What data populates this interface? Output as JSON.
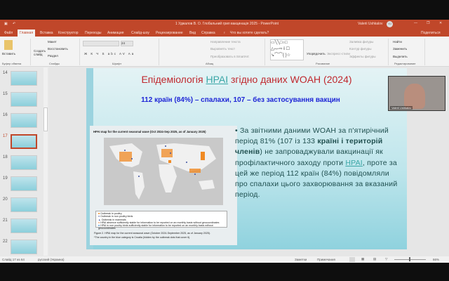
{
  "window": {
    "title": "1 Уджалов В. О. Глобальний грип вакцинація 2025 - PowerPoint",
    "user": "Valerii Ushkalov",
    "user_initials": "VU"
  },
  "tabs": [
    "Файл",
    "Главная",
    "Вставка",
    "Конструктор",
    "Переходы",
    "Анимация",
    "Слайд-шоу",
    "Рецензирование",
    "Вид",
    "Справка"
  ],
  "tell_me": "Что вы хотите сделать?",
  "share": "Поделиться",
  "ribbon": {
    "paste": "Вставить",
    "new_slide": "Создать слайд",
    "layout": "Макет",
    "reset": "Восстановить",
    "section": "Раздел",
    "font_size": "24",
    "text_direction": "Направление текста",
    "align_text": "Выровнять текст",
    "smartart": "Преобразовать в SmartArt",
    "arrange": "Упорядочить",
    "quick_styles": "Экспресс-стили",
    "fill": "Заливка фигуры",
    "outline": "Контур фигуры",
    "effects": "Эффекты фигуры",
    "find": "Найти",
    "replace": "Заменить",
    "select": "Выделить",
    "groups": [
      "Буфер обмена",
      "Слайды",
      "Шрифт",
      "Абзац",
      "Рисование",
      "Редактирование"
    ]
  },
  "thumbnails": [
    "14",
    "15",
    "16",
    "17",
    "18",
    "19",
    "20",
    "21",
    "22"
  ],
  "selected_slide": "17",
  "slide": {
    "title_a": "Епідеміологія ",
    "title_hpai": "HPAI",
    "title_b": " згідно  даних  WOAH (2024)",
    "subtitle": "112 країн (84%) – спалахи, 107 – без застосування вакцин",
    "map_title": "HPAI map for the current seasonal wave (Oct 2024-Sep 2025, as of January 2025)",
    "legend": [
      "Outbreak in poultry",
      "Outbreak in non poultry birds",
      "Outbreak in mammals",
      "HPAI absence sufficiently stable for information to be reported on an monthly basis without geocoordinates",
      "HPAI in non poultry birds sufficiently stable for information to be reported on an monthly basis without geocoordinates"
    ],
    "caption": "Figure 2. HPAI map for the current seasonal wave (October 2024-September 2025, as of January 2025).",
    "caption_note": "*The country in the blue category is Croatia (hidden by the outbreak dots that cover it).",
    "bullet_a": "За звітними даними WOAH за п'ятирічний період 81% (107 із 133 ",
    "bullet_bold": "країні і територій членів",
    "bullet_b": ") не запроваджували вакцинації як профілактичного заходу проти ",
    "bullet_hpai": "HPAI",
    "bullet_c": ", проте  за цей же період 112 країн (84%) повідомляли про спалахи цього захворювання за вказаний період."
  },
  "webcam_name": "Valerii Ushkalov",
  "status": {
    "slide": "Слайд 17 из 64",
    "language": "русский (Украина)",
    "notes": "Заметки",
    "comments": "Примечания",
    "zoom": "66%"
  },
  "colors": {
    "accent": "#c0472a",
    "title_red": "#c0272d",
    "subtitle_blue": "#1d24d6",
    "outbreak_poultry": "#f08a24",
    "outbreak_wild": "#3b4fa0"
  }
}
